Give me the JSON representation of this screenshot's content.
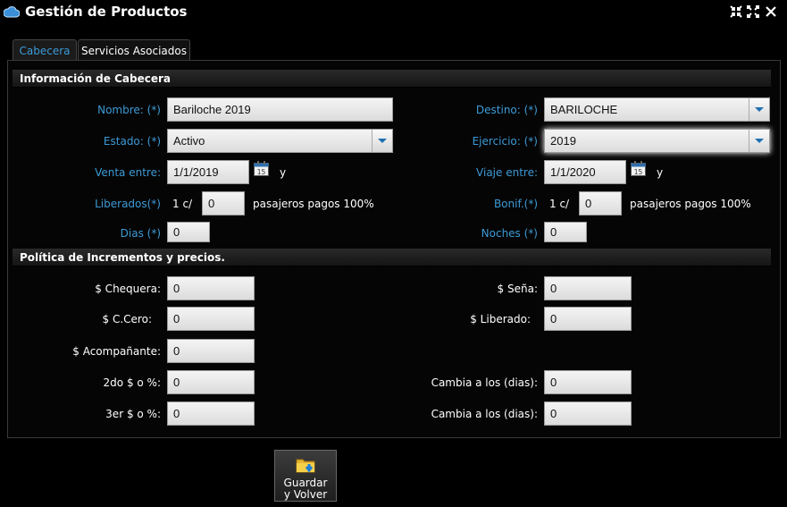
{
  "window": {
    "title": "Gestión de Productos"
  },
  "tabs": [
    {
      "label": "Cabecera"
    },
    {
      "label": "Servicios Asociados"
    }
  ],
  "header_section": {
    "title": "Información de Cabecera",
    "nombre": {
      "label": "Nombre: (*)",
      "value": "Bariloche 2019"
    },
    "destino": {
      "label": "Destino: (*)",
      "value": "BARILOCHE"
    },
    "estado": {
      "label": "Estado: (*)",
      "value": "Activo"
    },
    "ejercicio": {
      "label": "Ejercicio: (*)",
      "value": "2019"
    },
    "venta": {
      "label": "Venta entre:",
      "value": "1/1/2019",
      "suffix": "y"
    },
    "viaje": {
      "label": "Viaje entre:",
      "value": "1/1/2020",
      "suffix": "y"
    },
    "calendar_day": "15",
    "liberados": {
      "label": "Liberados(*)",
      "prefix": "1 c/",
      "value": "0",
      "suffix": "pasajeros pagos 100%"
    },
    "bonif": {
      "label": "Bonif.(*)",
      "prefix": "1 c/",
      "value": "0",
      "suffix": "pasajeros pagos 100%"
    },
    "dias": {
      "label": "Dias (*)",
      "value": "0"
    },
    "noches": {
      "label": "Noches (*)",
      "value": "0"
    }
  },
  "pricing_section": {
    "title": "Política de Incrementos y precios.",
    "chequera": {
      "label": "$ Chequera:",
      "value": "0"
    },
    "sena": {
      "label": "$ Seña:",
      "value": "0"
    },
    "ccero": {
      "label": "$ C.Cero:",
      "value": "0"
    },
    "liberado": {
      "label": "$ Liberado:",
      "value": "0"
    },
    "acompanante": {
      "label": "$ Acompañante:",
      "value": "0"
    },
    "segundo": {
      "label": "2do $ o %:",
      "value": "0"
    },
    "cambia1": {
      "label": "Cambia a los (dias):",
      "value": "0"
    },
    "tercero": {
      "label": "3er $ o %:",
      "value": "0"
    },
    "cambia2": {
      "label": "Cambia a los (dias):",
      "value": "0"
    }
  },
  "actions": {
    "save_label": "Guardar\ny Volver"
  },
  "colors": {
    "accent": "#3d9ad6",
    "background": "#000000"
  }
}
